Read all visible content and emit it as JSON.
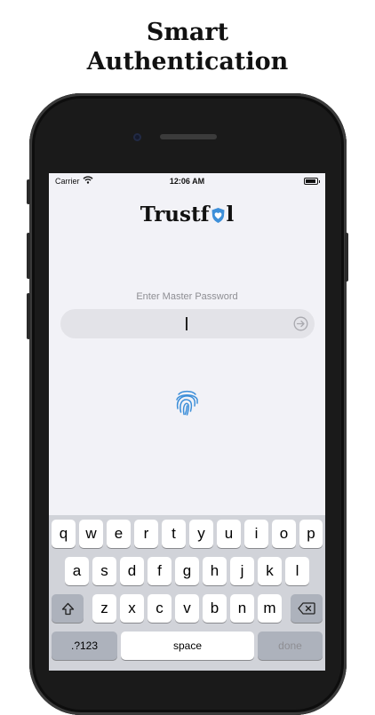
{
  "headline": {
    "line1": "Smart",
    "line2": "Authentication"
  },
  "status_bar": {
    "carrier": "Carrier",
    "time": "12:06 AM"
  },
  "app": {
    "logo_prefix": "Trustf",
    "logo_suffix": "l",
    "password_label": "Enter Master Password"
  },
  "keyboard": {
    "row1": [
      "q",
      "w",
      "e",
      "r",
      "t",
      "y",
      "u",
      "i",
      "o",
      "p"
    ],
    "row2": [
      "a",
      "s",
      "d",
      "f",
      "g",
      "h",
      "j",
      "k",
      "l"
    ],
    "row3": [
      "z",
      "x",
      "c",
      "v",
      "b",
      "n",
      "m"
    ],
    "numbers_key": ".?123",
    "space_key": "space",
    "done_key": "done"
  },
  "colors": {
    "brand_blue": "#3d8fd9",
    "screen_bg": "#f2f2f7",
    "keyboard_bg": "#d1d3d9"
  },
  "icons": [
    "wifi-icon",
    "battery-icon",
    "shield-heart-icon",
    "arrow-right-circle-icon",
    "fingerprint-icon",
    "shift-icon",
    "delete-icon"
  ]
}
